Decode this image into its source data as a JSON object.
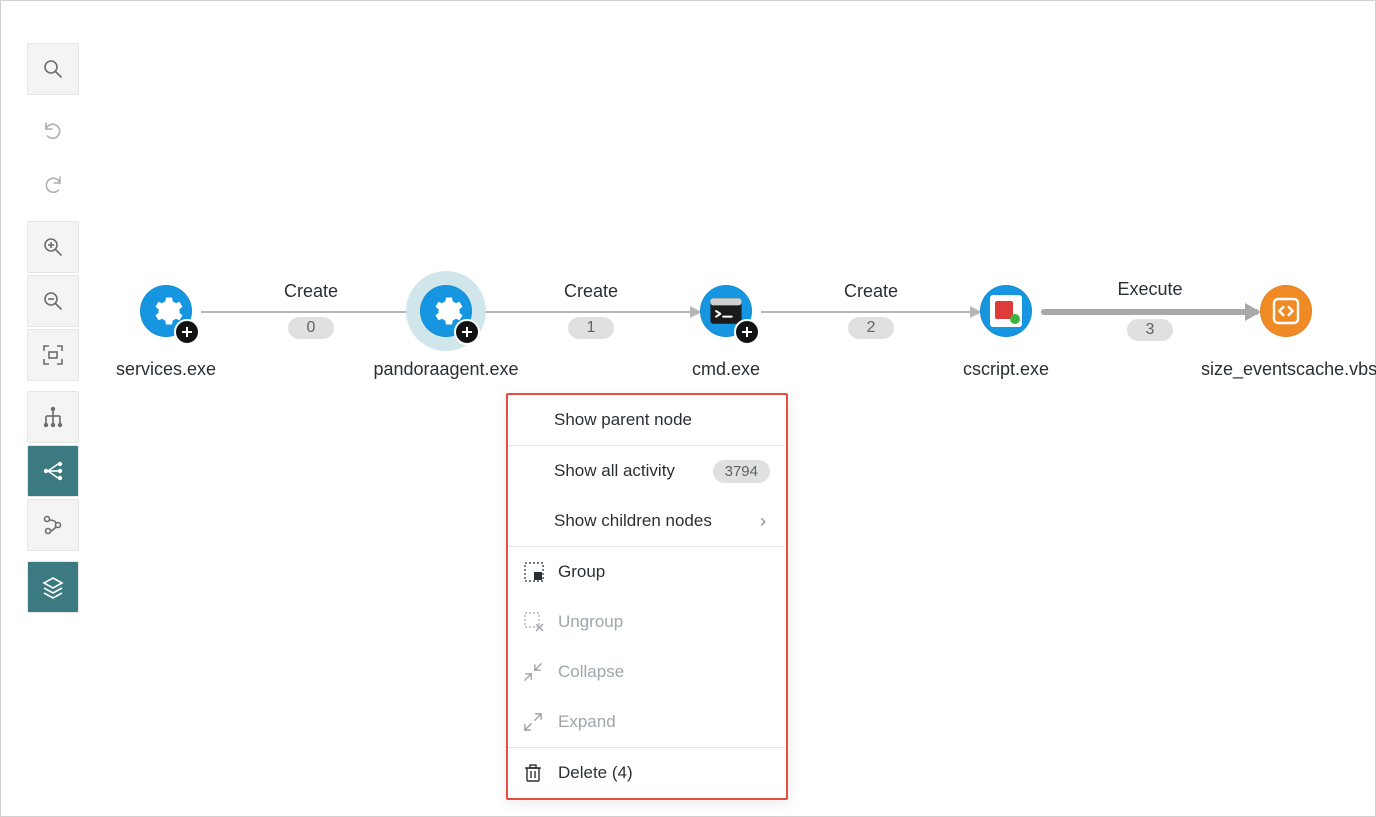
{
  "toolbar": {
    "search": "search-icon",
    "undo": "undo-icon",
    "redo": "redo-icon",
    "zoom_in": "zoom-in-icon",
    "zoom_out": "zoom-out-icon",
    "fit": "fit-screen-icon",
    "view_tree": "tree-view-icon",
    "view_graph": "graph-view-icon",
    "view_timeline": "timeline-view-icon",
    "layers": "layers-icon"
  },
  "graph": {
    "nodes": [
      {
        "id": "services",
        "label": "services.exe",
        "icon": "gear",
        "has_badge": true,
        "selected": false
      },
      {
        "id": "pandoraagent",
        "label": "pandoraagent.exe",
        "icon": "gear",
        "has_badge": true,
        "selected": true
      },
      {
        "id": "cmd",
        "label": "cmd.exe",
        "icon": "terminal",
        "has_badge": true,
        "selected": false
      },
      {
        "id": "cscript",
        "label": "cscript.exe",
        "icon": "cscript",
        "has_badge": false,
        "selected": false
      },
      {
        "id": "size_vbs",
        "label": "size_eventscache.vbs",
        "icon": "code",
        "has_badge": false,
        "selected": false,
        "orange": true
      }
    ],
    "edges": [
      {
        "from": "services",
        "to": "pandoraagent",
        "label": "Create",
        "badge": "0",
        "bold": false
      },
      {
        "from": "pandoraagent",
        "to": "cmd",
        "label": "Create",
        "badge": "1",
        "bold": false
      },
      {
        "from": "cmd",
        "to": "cscript",
        "label": "Create",
        "badge": "2",
        "bold": false
      },
      {
        "from": "cscript",
        "to": "size_vbs",
        "label": "Execute",
        "badge": "3",
        "bold": true
      }
    ]
  },
  "context_menu": {
    "show_parent": "Show parent node",
    "show_all_activity_label": "Show all activity",
    "show_all_activity_count": "3794",
    "show_children": "Show children nodes",
    "group": "Group",
    "ungroup": "Ungroup",
    "collapse": "Collapse",
    "expand": "Expand",
    "delete": "Delete (4)"
  }
}
